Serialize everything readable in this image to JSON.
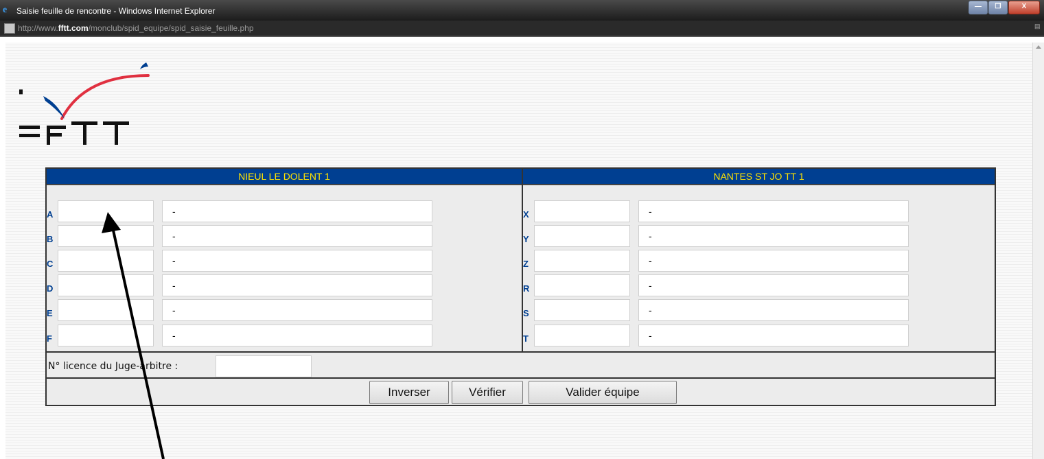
{
  "window": {
    "title": "Saisie feuille de rencontre - Windows Internet Explorer",
    "url_prefix": "http://www.",
    "url_domain": "fftt.com",
    "url_path": "/monclub/spid_equipe/spid_saisie_feuille.php",
    "buttons": [
      "—",
      "❐",
      "X"
    ]
  },
  "logo": {
    "text": "FFTT",
    "colors": {
      "arc": "#e03040",
      "swoosh": "#003f91",
      "text": "#111111"
    }
  },
  "home_team": {
    "name": "NIEUL LE DOLENT 1",
    "players": [
      {
        "slot": "A",
        "license": "",
        "name": "-"
      },
      {
        "slot": "B",
        "license": "",
        "name": "-"
      },
      {
        "slot": "C",
        "license": "",
        "name": "-"
      },
      {
        "slot": "D",
        "license": "",
        "name": "-"
      },
      {
        "slot": "E",
        "license": "",
        "name": "-"
      },
      {
        "slot": "F",
        "license": "",
        "name": "-"
      }
    ]
  },
  "away_team": {
    "name": "NANTES ST JO TT 1",
    "players": [
      {
        "slot": "X",
        "license": "",
        "name": "-"
      },
      {
        "slot": "Y",
        "license": "",
        "name": "-"
      },
      {
        "slot": "Z",
        "license": "",
        "name": "-"
      },
      {
        "slot": "R",
        "license": "",
        "name": "-"
      },
      {
        "slot": "S",
        "license": "",
        "name": "-"
      },
      {
        "slot": "T",
        "license": "",
        "name": "-"
      }
    ]
  },
  "referee": {
    "label": "N° licence du Juge-arbitre :",
    "value": ""
  },
  "actions": {
    "swap": "Inverser",
    "check": "Vérifier",
    "validate": "Valider équipe"
  },
  "colors": {
    "header_bg": "#003f91",
    "header_text": "#ffe300",
    "label_text": "#003f91"
  }
}
